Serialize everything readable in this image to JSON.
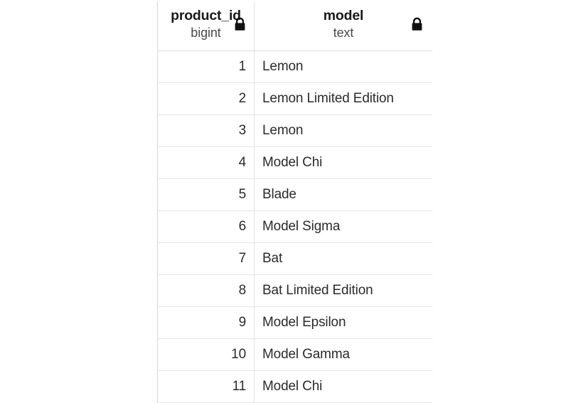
{
  "table": {
    "columns": [
      {
        "name": "product_id",
        "type": "bigint",
        "align": "right",
        "locked": true,
        "lock_icon": "lock-icon"
      },
      {
        "name": "model",
        "type": "text",
        "align": "left",
        "locked": true,
        "lock_icon": "lock-icon"
      }
    ],
    "rows": [
      {
        "product_id": "1",
        "model": "Lemon"
      },
      {
        "product_id": "2",
        "model": "Lemon Limited Edition"
      },
      {
        "product_id": "3",
        "model": "Lemon"
      },
      {
        "product_id": "4",
        "model": "Model Chi"
      },
      {
        "product_id": "5",
        "model": "Blade"
      },
      {
        "product_id": "6",
        "model": "Model Sigma"
      },
      {
        "product_id": "7",
        "model": "Bat"
      },
      {
        "product_id": "8",
        "model": "Bat Limited Edition"
      },
      {
        "product_id": "9",
        "model": "Model Epsilon"
      },
      {
        "product_id": "10",
        "model": "Model Gamma"
      },
      {
        "product_id": "11",
        "model": "Model Chi"
      }
    ],
    "colors": {
      "header_text": "#1a1a1a",
      "type_text": "#4a4a4a",
      "cell_text": "#2b2b2b",
      "row_border": "#e6e6e6",
      "column_border": "#e2e2e2",
      "background": "#ffffff",
      "lock_icon": "#111111"
    }
  }
}
